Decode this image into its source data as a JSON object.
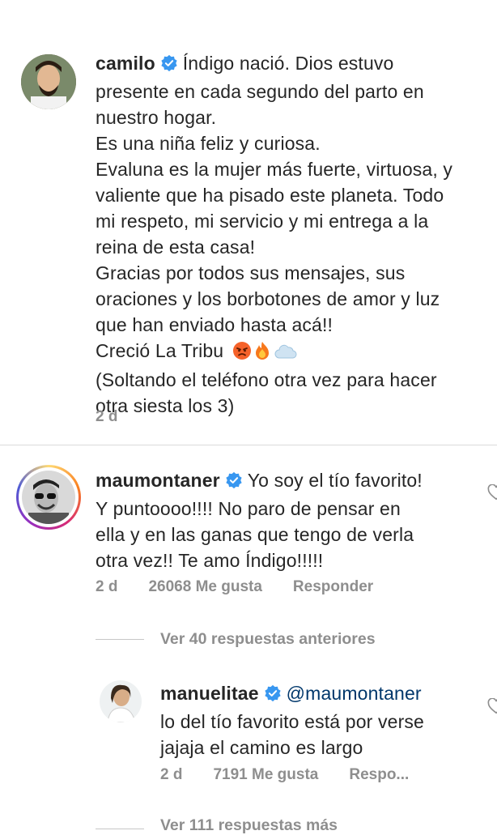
{
  "comments": [
    {
      "username": "camilo",
      "lines": [
        "Índigo nació. Dios estuvo",
        "presente en cada segundo del parto en",
        "nuestro hogar.",
        "Es una niña feliz y curiosa.",
        "Evaluna es la mujer más fuerte, virtuosa, y",
        "valiente que ha pisado este planeta. Todo",
        "mi respeto, mi servicio y mi entrega a la",
        "reina de esta casa!",
        "Gracias por todos sus mensajes, sus",
        "oraciones y los borbotones de amor y luz",
        "que han enviado hasta acá!!",
        "Creció La Tribu",
        "(Soltando el teléfono otra vez para hacer",
        "otra siesta los 3)"
      ],
      "emojis": [
        "😡",
        "🔥",
        "☁️"
      ],
      "time": "2 d"
    },
    {
      "username": "maumontaner",
      "lines": [
        "Yo soy el tío favorito!",
        "Y puntoooo!!!! No paro de pensar en",
        "ella y en las ganas que tengo de verla",
        "otra vez!! Te amo Índigo!!!!!"
      ],
      "time": "2 d",
      "likes": "26068 Me gusta",
      "reply": "Responder"
    }
  ],
  "view_previous": "Ver 40 respuestas anteriores",
  "reply_comment": {
    "username": "manuelitae",
    "mention": "@maumontaner",
    "lines": [
      "lo del tío favorito está por verse",
      "jajaja el camino es largo"
    ],
    "time": "2 d",
    "likes": "7191 Me gusta",
    "reply": "Respo..."
  },
  "view_more": "Ver 111 respuestas más"
}
